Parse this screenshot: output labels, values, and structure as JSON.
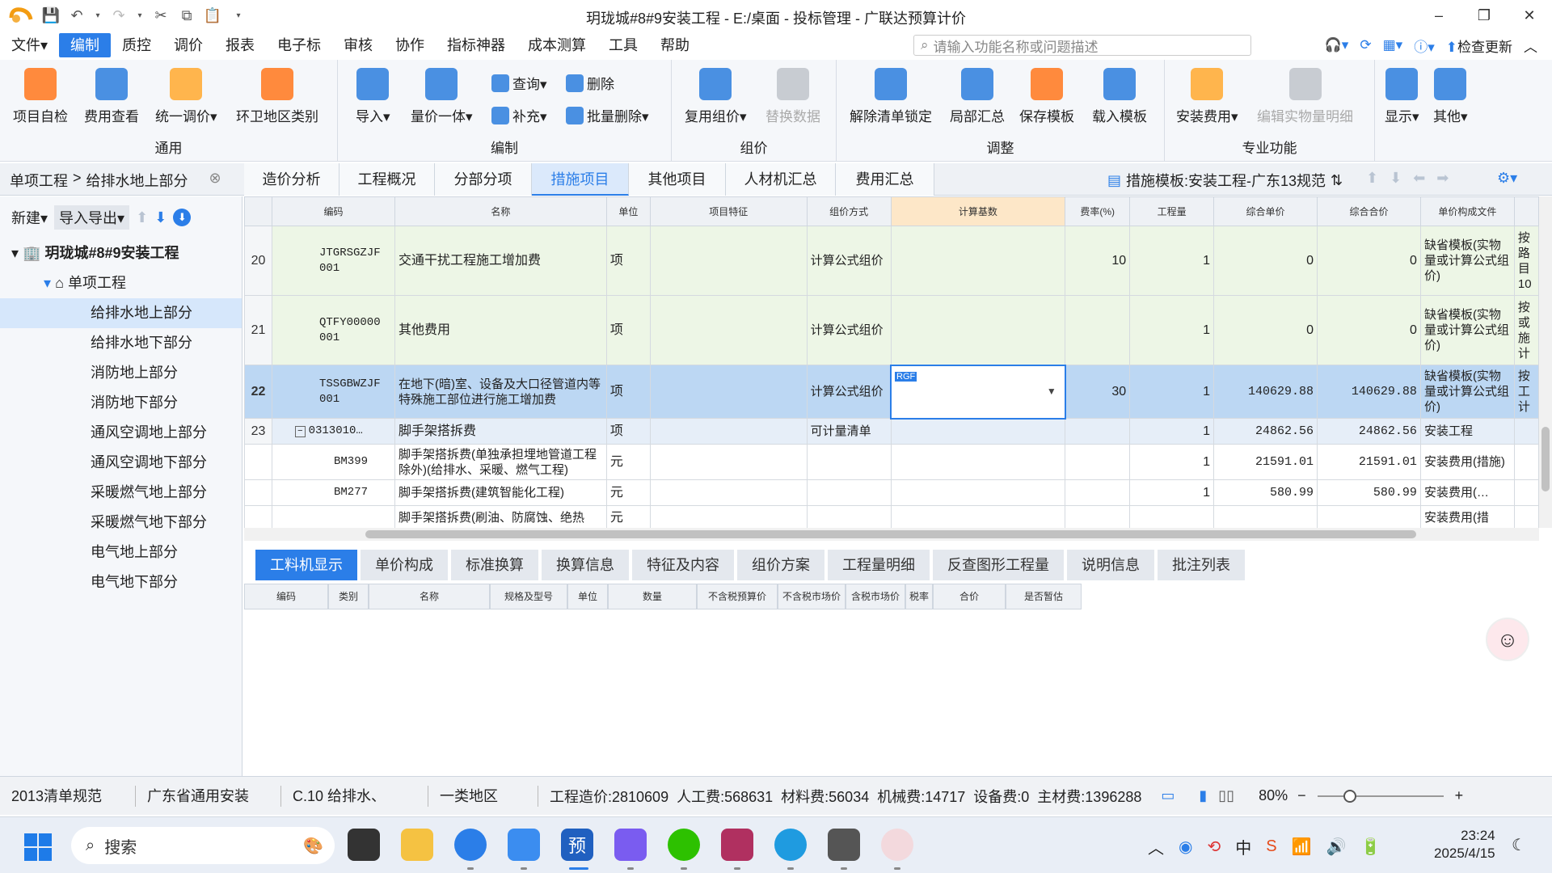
{
  "window": {
    "title": "玥珑城#8#9安装工程 - E:/桌面 - 投标管理 - 广联达预算计价",
    "min": "–",
    "max": "❐",
    "close": "✕"
  },
  "menu": {
    "items": [
      "文件▾",
      "编制",
      "质控",
      "调价",
      "报表",
      "电子标",
      "审核",
      "协作",
      "指标神器",
      "成本测算",
      "工具",
      "帮助"
    ],
    "search_placeholder": "请输入功能名称或问题描述",
    "check_update": "检查更新"
  },
  "ribbon": {
    "groups": {
      "tongyong": "通用",
      "bianzhi": "编制",
      "zujia": "组价",
      "tiaozheng": "调整",
      "zhuanye": "专业功能"
    },
    "buttons": {
      "self_check": "项目自检",
      "fee_view": "费用查看",
      "unify_price": "统一调价▾",
      "env_category": "环卫地区类别",
      "import": "导入▾",
      "quantity_price": "量价一体▾",
      "query": "查询▾",
      "supplement": "补充▾",
      "delete": "删除",
      "batch_delete": "批量删除▾",
      "reuse_group": "复用组价▾",
      "replace_data": "替换数据",
      "unlock_list": "解除清单锁定",
      "local_summary": "局部汇总",
      "save_template": "保存模板",
      "load_template": "载入模板",
      "install_fee": "安装费用▾",
      "edit_detail": "编辑实物量明细",
      "display": "显示▾",
      "other": "其他▾"
    }
  },
  "tabs": {
    "crumb_a": "单项工程",
    "crumb_sep": ">",
    "crumb_b": "给排水地上部分",
    "items": [
      "造价分析",
      "工程概况",
      "分部分项",
      "措施项目",
      "其他项目",
      "人材机汇总",
      "费用汇总"
    ],
    "template_label": "措施模板:安装工程-广东13规范"
  },
  "left": {
    "new": "新建▾",
    "import_export": "导入导出▾",
    "root": "玥珑城#8#9安装工程",
    "group": "单项工程",
    "items": [
      "给排水地上部分",
      "给排水地下部分",
      "消防地上部分",
      "消防地下部分",
      "通风空调地上部分",
      "通风空调地下部分",
      "采暖燃气地上部分",
      "采暖燃气地下部分",
      "电气地上部分",
      "电气地下部分"
    ]
  },
  "grid": {
    "headers": [
      "编码",
      "名称",
      "单位",
      "项目特征",
      "组价方式",
      "计算基数",
      "费率(%)",
      "工程量",
      "综合单价",
      "综合合价",
      "单价构成文件",
      ""
    ],
    "rows": [
      {
        "rn": "20",
        "code": "JTGRSGZJF 001",
        "name": "交通干扰工程施工增加费",
        "unit": "项",
        "feature": "",
        "method": "计算公式组价",
        "base": "",
        "rate": "10",
        "qty": "1",
        "price": "0",
        "total": "0",
        "file": "缺省模板(实物量或计算公式组价)",
        "extra": "按路目10"
      },
      {
        "rn": "21",
        "code": "QTFY00000 001",
        "name": "其他费用",
        "unit": "项",
        "feature": "",
        "method": "计算公式组价",
        "base": "",
        "rate": "",
        "qty": "1",
        "price": "0",
        "total": "0",
        "file": "缺省模板(实物量或计算公式组价)",
        "extra": "按或施计"
      },
      {
        "rn": "22",
        "code": "TSSGBWZJF 001",
        "name": "在地下(暗)室、设备及大口径管道内等特殊施工部位进行施工增加费",
        "unit": "项",
        "feature": "",
        "method": "计算公式组价",
        "base": "RGF",
        "rate": "30",
        "qty": "1",
        "price": "140629.88",
        "total": "140629.88",
        "file": "缺省模板(实物量或计算公式组价)",
        "extra": "按工计"
      },
      {
        "rn": "23",
        "code": "0313010…",
        "name": "脚手架搭拆费",
        "unit": "项",
        "feature": "",
        "method": "可计量清单",
        "base": "",
        "rate": "",
        "qty": "1",
        "price": "24862.56",
        "total": "24862.56",
        "file": "安装工程",
        "extra": ""
      },
      {
        "rn": "",
        "code": "BM399",
        "name": "脚手架搭拆费(单独承担埋地管道工程除外)(给排水、采暖、燃气工程)",
        "unit": "元",
        "feature": "",
        "method": "",
        "base": "",
        "rate": "",
        "qty": "1",
        "price": "21591.01",
        "total": "21591.01",
        "file": "安装费用(措施)",
        "extra": ""
      },
      {
        "rn": "",
        "code": "BM277",
        "name": "脚手架搭拆费(建筑智能化工程)",
        "unit": "元",
        "feature": "",
        "method": "",
        "base": "",
        "rate": "",
        "qty": "1",
        "price": "580.99",
        "total": "580.99",
        "file": "安装费用(…",
        "extra": ""
      },
      {
        "rn": "",
        "code": "",
        "name": "脚手架搭拆费(刷油、防腐蚀、绝热",
        "unit": "元",
        "feature": "",
        "method": "",
        "base": "",
        "rate": "",
        "qty": "",
        "price": "",
        "total": "",
        "file": "安装费用(措",
        "extra": ""
      }
    ]
  },
  "bottom": {
    "tabs": [
      "工料机显示",
      "单价构成",
      "标准换算",
      "换算信息",
      "特征及内容",
      "组价方案",
      "工程量明细",
      "反查图形工程量",
      "说明信息",
      "批注列表"
    ],
    "subheaders": [
      "编码",
      "类别",
      "名称",
      "规格及型号",
      "单位",
      "数量",
      "不含税预算价",
      "不含税市场价",
      "含税市场价",
      "税率",
      "合价",
      "是否暂估"
    ]
  },
  "status": {
    "spec": "2013清单规范",
    "region_std": "广东省通用安装",
    "chapter": "C.10 给排水、",
    "area": "一类地区",
    "total_cost": "工程造价:2810609",
    "labor": "人工费:568631",
    "material": "材料费:56034",
    "machine": "机械费:14717",
    "equipment": "设备费:0",
    "main_material": "主材费:1396288",
    "zoom": "80%"
  },
  "taskbar": {
    "search": "搜索",
    "ime": "中",
    "time": "23:24",
    "date": "2025/4/15"
  },
  "colors": {
    "accent": "#2b7ee8",
    "row_green": "#edf6e6",
    "row_selected": "#bcd7f3"
  }
}
